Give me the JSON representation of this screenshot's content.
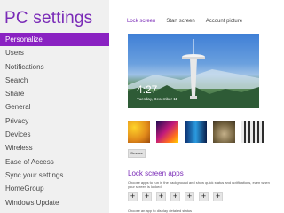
{
  "sidebar": {
    "title": "PC settings",
    "selected_index": 0,
    "items": [
      {
        "label": "Personalize"
      },
      {
        "label": "Users"
      },
      {
        "label": "Notifications"
      },
      {
        "label": "Search"
      },
      {
        "label": "Share"
      },
      {
        "label": "General"
      },
      {
        "label": "Privacy"
      },
      {
        "label": "Devices"
      },
      {
        "label": "Wireless"
      },
      {
        "label": "Ease of Access"
      },
      {
        "label": "Sync your settings"
      },
      {
        "label": "HomeGroup"
      },
      {
        "label": "Windows Update"
      }
    ]
  },
  "main": {
    "tabs": [
      {
        "label": "Lock screen",
        "active": true
      },
      {
        "label": "Start screen",
        "active": false
      },
      {
        "label": "Account picture",
        "active": false
      }
    ],
    "preview": {
      "time": "4:27",
      "date": "Tuesday, December 11"
    },
    "browse_label": "Browse",
    "lock_screen_apps": {
      "title": "Lock screen apps",
      "description": "Choose apps to run in the background and show quick status and notifications, even when your screen is locked",
      "plus_glyph": "+",
      "detail_description": "Choose an app to display detailed status"
    }
  },
  "colors": {
    "accent": "#7a2bb7",
    "selected_bg": "#8a22c2",
    "sidebar_bg": "#f0f0f0"
  },
  "icons": {
    "add_app": "plus-icon"
  }
}
